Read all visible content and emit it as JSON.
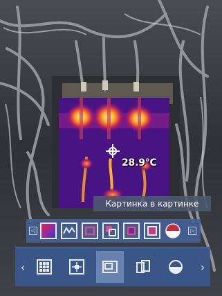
{
  "thermal": {
    "temperature": "28.9°C"
  },
  "tooltip": {
    "text": "Картинка в картинке"
  },
  "palette_bar": {
    "items": [
      {
        "icon": "palette-red-blue-icon"
      },
      {
        "icon": "palette-zigzag-icon"
      },
      {
        "icon": "palette-square-icon"
      },
      {
        "icon": "palette-split-icon"
      },
      {
        "icon": "palette-inner-square-icon"
      },
      {
        "icon": "palette-square-white-icon"
      },
      {
        "icon": "palette-half-circle-icon"
      }
    ]
  },
  "mode_bar": {
    "items": [
      {
        "icon": "grid-icon"
      },
      {
        "icon": "center-point-icon"
      },
      {
        "icon": "picture-in-picture-icon",
        "selected": true
      },
      {
        "icon": "side-by-side-icon"
      },
      {
        "icon": "blend-circle-icon"
      }
    ]
  }
}
